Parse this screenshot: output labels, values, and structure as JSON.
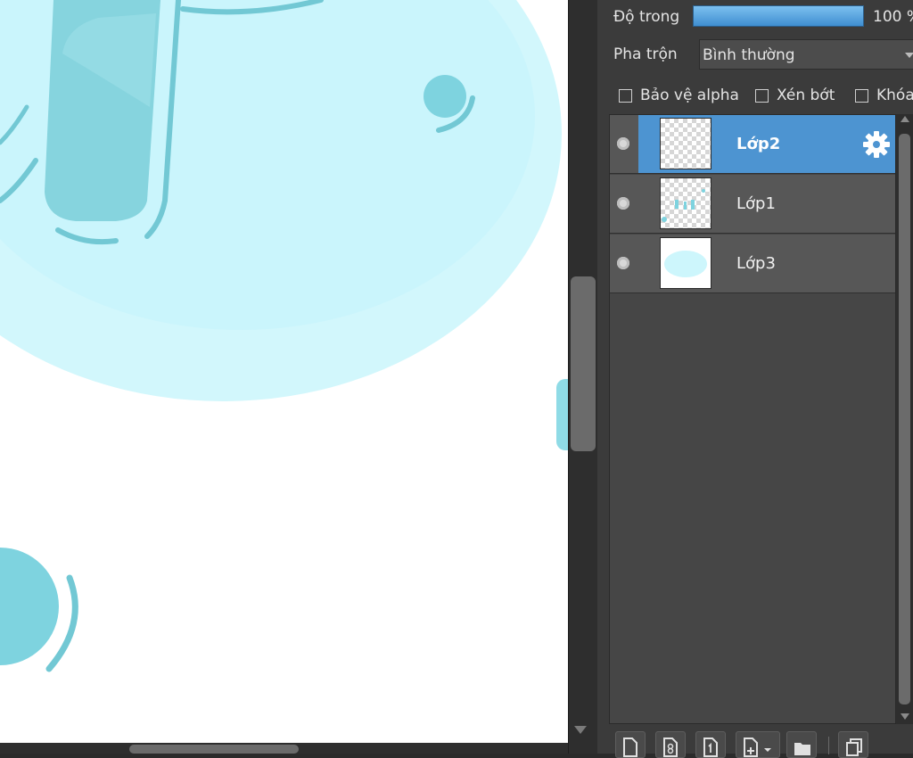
{
  "colors": {
    "accent": "#4d94d1",
    "canvas_shape_light": "#cdf6fc",
    "canvas_shape_dark": "#7ed3df",
    "panel_bg": "#3b3b3b"
  },
  "panel": {
    "opacity_label": "Độ trong",
    "opacity_value": "100 %",
    "opacity_fraction": 1.0,
    "blend_label": "Pha trộn",
    "blend_value": "Bình thường",
    "checkboxes": [
      {
        "label": "Bảo vệ alpha",
        "checked": false
      },
      {
        "label": "Xén bớt",
        "checked": false
      },
      {
        "label": "Khóa",
        "checked": false
      }
    ],
    "layers": [
      {
        "name": "Lớp2",
        "selected": true,
        "visible": true
      },
      {
        "name": "Lớp1",
        "selected": false,
        "visible": true
      },
      {
        "name": "Lớp3",
        "selected": false,
        "visible": true
      }
    ]
  },
  "icons": {
    "layer_settings": "gear-icon",
    "visibility": "eye-icon",
    "toolbar": [
      "new-layer-icon",
      "new-8bit-layer-icon",
      "new-1bit-layer-icon",
      "add-layer-dropdown-icon",
      "folder-icon",
      "duplicate-layer-icon"
    ]
  }
}
